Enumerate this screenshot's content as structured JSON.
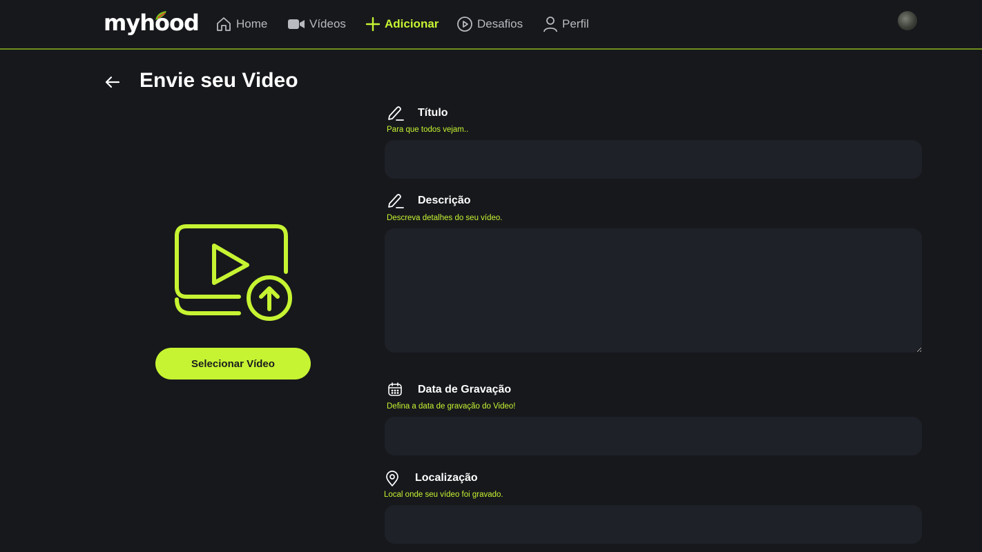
{
  "brand": {
    "logo_text": "myhood",
    "accent": "#c6f432"
  },
  "nav": {
    "items": [
      {
        "label": "Home",
        "icon": "home-icon"
      },
      {
        "label": "Vídeos",
        "icon": "video-camera-icon"
      },
      {
        "label": "Adicionar",
        "icon": "plus-icon",
        "active": true
      },
      {
        "label": "Desafios",
        "icon": "play-circle-icon"
      },
      {
        "label": "Perfil",
        "icon": "user-icon"
      }
    ]
  },
  "page": {
    "title": "Envie seu Video"
  },
  "upload": {
    "button_label": "Selecionar Vídeo",
    "icon": "video-upload-icon"
  },
  "form": {
    "title": {
      "label": "Título",
      "hint": "Para que todos vejam..",
      "value": "",
      "icon": "pencil-icon"
    },
    "description": {
      "label": "Descrição",
      "hint": "Descreva detalhes do seu vídeo.",
      "value": "",
      "icon": "pencil-icon"
    },
    "date": {
      "label": "Data de Gravação",
      "hint": "Defina a data de gravação do Video!",
      "value": "",
      "icon": "calendar-icon"
    },
    "location": {
      "label": "Localização",
      "hint": "Local onde seu vídeo foi gravado.",
      "value": "",
      "icon": "location-pin-icon"
    }
  }
}
